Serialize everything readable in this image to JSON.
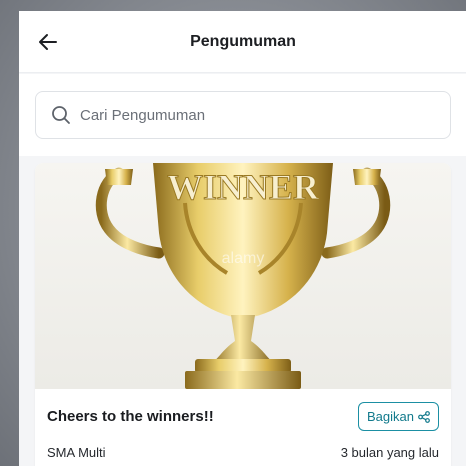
{
  "header": {
    "title": "Pengumuman",
    "back_icon": "arrow-left-icon"
  },
  "search": {
    "placeholder": "Cari Pengumuman",
    "icon": "search-icon"
  },
  "announcements": [
    {
      "image_text": "WINNER",
      "image_watermark": "alamy",
      "title": "Cheers to the winners!!",
      "share_label": "Bagikan",
      "share_icon": "share-icon",
      "source": "SMA Multi",
      "time": "3 bulan yang lalu"
    }
  ],
  "colors": {
    "accent": "#1b8fa3",
    "background": "#f4f5f7",
    "trophy_gold": "#d9b84a"
  }
}
